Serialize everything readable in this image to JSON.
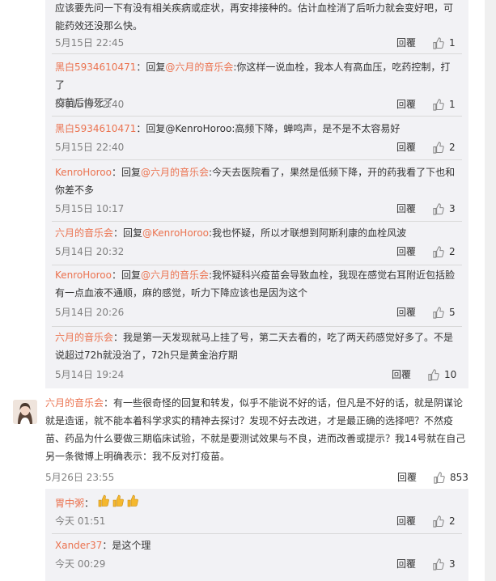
{
  "reply_label": "回覆",
  "replies_top": [
    {
      "text_lines": [
        "应该要先问一下有没有相关疾病或症状，再安排接种的。估计血栓消了后听力就会变好吧，可",
        "能药效还没那么快。"
      ],
      "time": "5月15日 22:45",
      "likes": "1"
    },
    {
      "user": "黑白5934610471",
      "prefix": "：回复",
      "at": "@六月的音乐会",
      "text_lines": [
        ":你这样一说血栓，我本人有高血压，吃药控制，打了",
        "疫苗后悔死了"
      ],
      "time": "5月15日 22:40",
      "likes": "1"
    },
    {
      "user": "黑白5934610471",
      "prefix": "：回复",
      "at": "@KenroHoroo",
      "text_lines": [
        ":高频下降，蝉鸣声，是不是不太容易好"
      ],
      "time": "5月15日 22:40",
      "likes": "2"
    },
    {
      "user": "KenroHoroo",
      "prefix": "：回复",
      "at": "@六月的音乐会",
      "text_lines": [
        ":今天去医院看了，果然是低频下降，开的药我看了下也和",
        "你差不多"
      ],
      "time": "5月15日 10:17",
      "likes": "3"
    },
    {
      "user": "六月的音乐会",
      "prefix": "：回复",
      "at": "@KenroHoroo",
      "text_lines": [
        ":我也怀疑，所以才联想到阿斯利康的血栓风波"
      ],
      "time": "5月14日 20:32",
      "likes": "2"
    },
    {
      "user": "KenroHoroo",
      "prefix": "：回复",
      "at": "@六月的音乐会",
      "text_lines": [
        ":我怀疑科兴疫苗会导致血栓，我现在感觉右耳附近包括脸",
        "有一点血液不通顺，麻的感觉，听力下降应该也是因为这个"
      ],
      "time": "5月14日 20:26",
      "likes": "5"
    },
    {
      "user": "六月的音乐会",
      "prefix": "",
      "at": "",
      "text_lines": [
        "：我是第一天发现就马上挂了号，第二天去看的，吃了两天药感觉好多了。不是",
        "说超过72h就没治了，72h只是黄金治疗期"
      ],
      "time": "5月14日 19:24",
      "likes": "10"
    }
  ],
  "main_comment": {
    "user": "六月的音乐会",
    "text_lines": [
      "：有一些很奇怪的回复和转发，似乎不能说不好的话，但凡是不好的话，就是阴谋论",
      "就是造谣，就不能本着科学求实的精神去探讨？发现不好去改进，才是最正确的选择吧？不然疫",
      "苗、药品为什么要做三期临床试验，不就是要测试效果与不良，进而改善或提示？我14号就在自己",
      "另一条微博上明确表示：我不反对打疫苗。"
    ],
    "time": "5月26日 23:55",
    "likes": "853"
  },
  "replies_bottom": [
    {
      "user": "胃中粥",
      "text": "：",
      "emoji": "thumbs-up-emoji ×3",
      "time": "今天 01:51",
      "likes": "2"
    },
    {
      "user": "Xander37",
      "text": "：是这个理",
      "time": "今天 00:29",
      "likes": "3"
    }
  ],
  "colors": {
    "link": "#eb7350",
    "panel": "#f2f2f5",
    "meta": "#808080"
  }
}
